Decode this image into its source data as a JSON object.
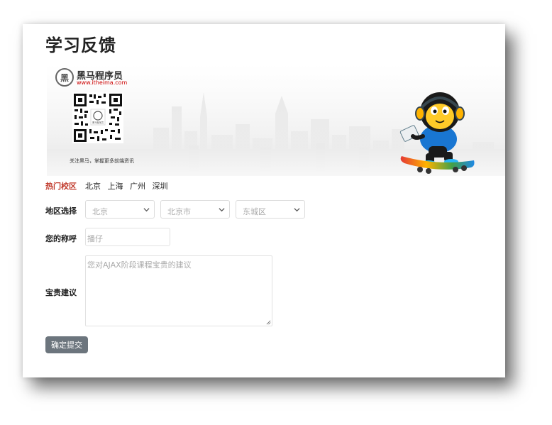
{
  "page": {
    "title": "学习反馈"
  },
  "banner": {
    "brand_name": "黑马程序员",
    "brand_url": "www.itheima.com",
    "qr_caption": "关注黑马，掌握更多前端资讯",
    "qr_center_text": "黑马程序员"
  },
  "hot_campus": {
    "label": "热门校区",
    "items": [
      "北京",
      "上海",
      "广州",
      "深圳"
    ]
  },
  "region": {
    "label": "地区选择",
    "province": "北京",
    "city": "北京市",
    "district": "东城区"
  },
  "nickname": {
    "label": "您的称呼",
    "placeholder": "播仔"
  },
  "suggestion": {
    "label": "宝贵建议",
    "placeholder": "您对AJAX阶段课程宝贵的建议"
  },
  "submit_label": "确定提交",
  "colors": {
    "hot_label": "#c0392b",
    "button": "#6c757d",
    "brand_url": "#cc0000"
  }
}
